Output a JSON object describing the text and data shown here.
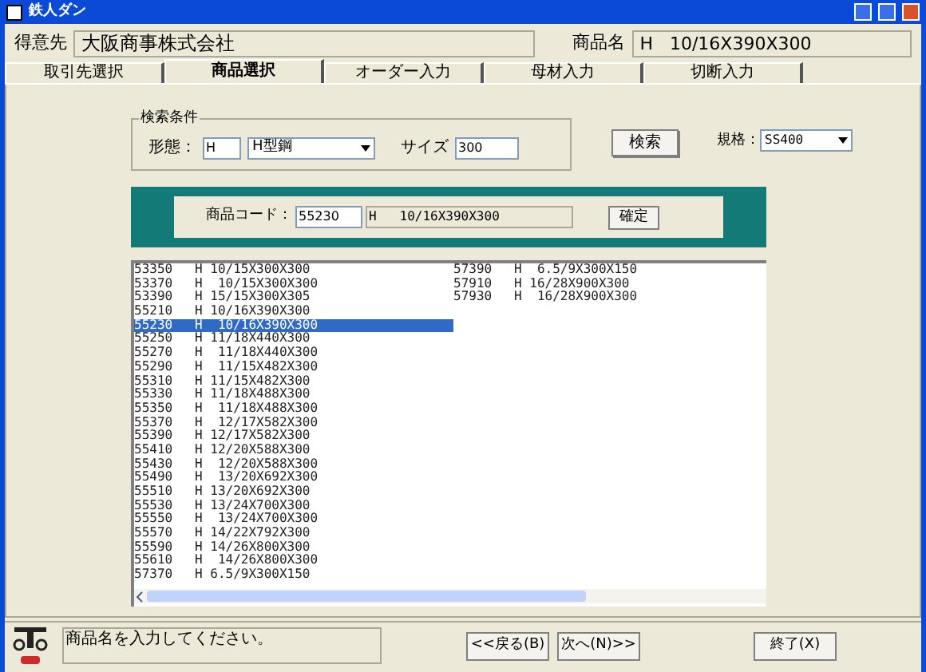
{
  "window": {
    "title": "鉄人ダン"
  },
  "header": {
    "customer_label": "得意先",
    "customer_value": "大阪商事株式会社",
    "product_label": "商品名",
    "product_value": "H   10/16X390X300"
  },
  "tabs": [
    {
      "label": "取引先選択",
      "selected": false
    },
    {
      "label": "商品選択",
      "selected": true
    },
    {
      "label": "オーダー入力",
      "selected": false
    },
    {
      "label": "母材入力",
      "selected": false
    },
    {
      "label": "切断入力",
      "selected": false
    }
  ],
  "search": {
    "group_title": "検索条件",
    "shape_label": "形態：",
    "shape_code": "H",
    "shape_select": "H型鋼",
    "size_label": "サイズ",
    "size_value": "300",
    "search_button": "検索",
    "grade_label": "規格：",
    "grade_select": "SS400"
  },
  "code_panel": {
    "label": "商品コード：",
    "code": "55230",
    "name": "H   10/16X390X300",
    "confirm_button": "確定"
  },
  "list": [
    {
      "code": "53350",
      "name": "H 10/15X300X300",
      "selected": false
    },
    {
      "code": "53370",
      "name": "H  10/15X300X300",
      "selected": false
    },
    {
      "code": "53390",
      "name": "H 15/15X300X305",
      "selected": false
    },
    {
      "code": "55210",
      "name": "H 10/16X390X300",
      "selected": false
    },
    {
      "code": "55230",
      "name": "H  10/16X390X300",
      "selected": true
    },
    {
      "code": "55250",
      "name": "H 11/18X440X300",
      "selected": false
    },
    {
      "code": "55270",
      "name": "H  11/18X440X300",
      "selected": false
    },
    {
      "code": "55290",
      "name": "H  11/15X482X300",
      "selected": false
    },
    {
      "code": "55310",
      "name": "H 11/15X482X300",
      "selected": false
    },
    {
      "code": "55330",
      "name": "H 11/18X488X300",
      "selected": false
    },
    {
      "code": "55350",
      "name": "H  11/18X488X300",
      "selected": false
    },
    {
      "code": "55370",
      "name": "H  12/17X582X300",
      "selected": false
    },
    {
      "code": "55390",
      "name": "H 12/17X582X300",
      "selected": false
    },
    {
      "code": "55410",
      "name": "H 12/20X588X300",
      "selected": false
    },
    {
      "code": "55430",
      "name": "H  12/20X588X300",
      "selected": false
    },
    {
      "code": "55490",
      "name": "H  13/20X692X300",
      "selected": false
    },
    {
      "code": "55510",
      "name": "H 13/20X692X300",
      "selected": false
    },
    {
      "code": "55530",
      "name": "H 13/24X700X300",
      "selected": false
    },
    {
      "code": "55550",
      "name": "H  13/24X700X300",
      "selected": false
    },
    {
      "code": "55570",
      "name": "H 14/22X792X300",
      "selected": false
    },
    {
      "code": "55590",
      "name": "H 14/26X800X300",
      "selected": false
    },
    {
      "code": "55610",
      "name": "H  14/26X800X300",
      "selected": false
    },
    {
      "code": "57370",
      "name": "H 6.5/9X300X150",
      "selected": false
    },
    {
      "code": "57390",
      "name": "H  6.5/9X300X150",
      "selected": false
    },
    {
      "code": "57910",
      "name": "H 16/28X900X300",
      "selected": false
    },
    {
      "code": "57930",
      "name": "H  16/28X900X300",
      "selected": false
    }
  ],
  "status_bar": {
    "message": "商品名を入力してください。",
    "buttons": [
      "<<戻る(B)",
      "次へ(N)>>",
      "終了(X)"
    ]
  }
}
